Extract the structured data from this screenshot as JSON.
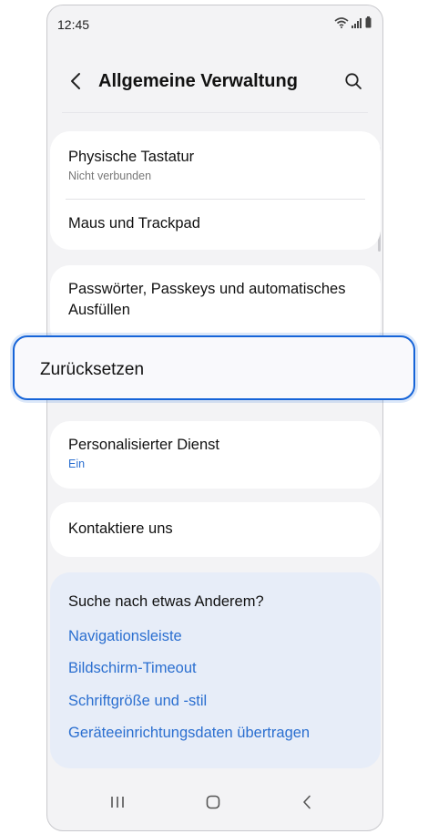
{
  "status_bar": {
    "time": "12:45"
  },
  "header": {
    "title": "Allgemeine Verwaltung"
  },
  "groups": {
    "input": {
      "physical_keyboard": {
        "title": "Physische Tastatur",
        "subtitle": "Nicht verbunden"
      },
      "mouse": {
        "title": "Maus und Trackpad"
      }
    },
    "passwords": {
      "title_line1": "Passwörter, Passkeys und automatisches",
      "title_line2": "Ausfüllen"
    },
    "reset": {
      "title": "Zurücksetzen"
    },
    "personalized": {
      "title": "Personalisierter Dienst",
      "subtitle": "Ein"
    },
    "contact": {
      "title": "Kontaktiere uns"
    }
  },
  "suggestions": {
    "title": "Suche nach etwas Anderem?",
    "links": [
      "Navigationsleiste",
      "Bildschirm-Timeout",
      "Schriftgröße und -stil",
      "Geräteeinrichtungsdaten übertragen"
    ]
  },
  "colors": {
    "accent": "#1664d8",
    "link": "#2b6fd0",
    "suggest_bg": "#e7edf8",
    "page_bg": "#f3f3f5"
  },
  "icons": {
    "back": "chevron-left-icon",
    "search": "search-icon",
    "recents": "recents-icon",
    "home": "home-icon",
    "nav_back": "nav-back-icon"
  }
}
